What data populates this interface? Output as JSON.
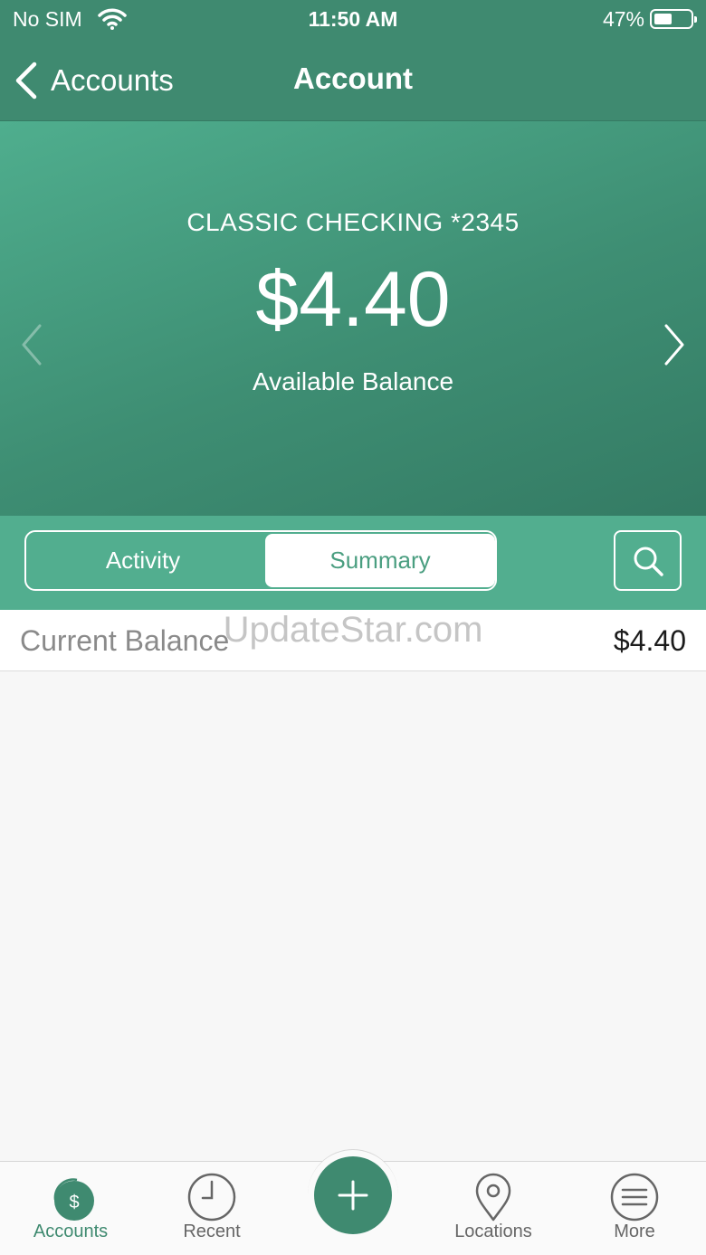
{
  "status_bar": {
    "carrier": "No SIM",
    "time": "11:50 AM",
    "battery_percent": "47%"
  },
  "nav": {
    "back_label": "Accounts",
    "title": "Account"
  },
  "account": {
    "name": "CLASSIC CHECKING *2345",
    "balance": "$4.40",
    "balance_label": "Available Balance"
  },
  "segments": {
    "activity_label": "Activity",
    "summary_label": "Summary",
    "selected": "Summary"
  },
  "summary": {
    "rows": [
      {
        "label": "Current Balance",
        "value": "$4.40"
      }
    ]
  },
  "watermark": "UpdateStar.com",
  "tabbar": {
    "items": [
      {
        "label": "Accounts",
        "icon": "accounts-dollar-icon",
        "active": true
      },
      {
        "label": "Recent",
        "icon": "clock-icon",
        "active": false
      },
      {
        "label": "",
        "icon": "plus-icon",
        "active": false
      },
      {
        "label": "Locations",
        "icon": "location-pin-icon",
        "active": false
      },
      {
        "label": "More",
        "icon": "menu-icon",
        "active": false
      }
    ]
  },
  "colors": {
    "brand_dark": "#3f8a70",
    "brand_light": "#52ae8f",
    "background": "#f7f7f7"
  }
}
